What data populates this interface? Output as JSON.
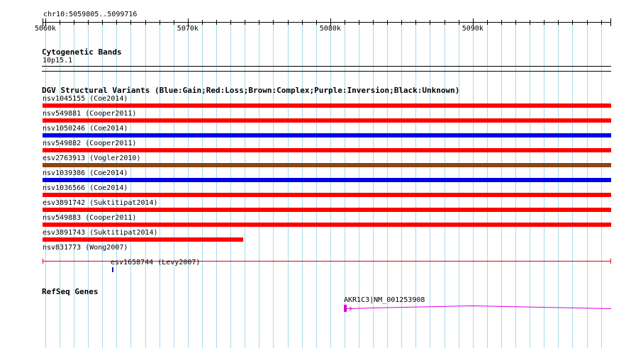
{
  "ruler": {
    "position_label": "chr10:5059805..5099716",
    "region_start": 5059805,
    "region_end": 5099716,
    "ticks": [
      {
        "pos": 5060000,
        "label": "5060k"
      },
      {
        "pos": 5070000,
        "label": "5070k"
      },
      {
        "pos": 5080000,
        "label": "5080k"
      },
      {
        "pos": 5090000,
        "label": "5090k"
      }
    ]
  },
  "cytobands": {
    "title": "Cytogenetic Bands",
    "band_label": "10p15.1"
  },
  "dgv": {
    "title": "DGV Structural Variants (Blue:Gain;Red:Loss;Brown:Complex;Purple:Inversion;Black:Unknown)",
    "colors": {
      "gain": "#0000e6",
      "loss": "#ff0000",
      "complex": "#8b4513",
      "line": "#ee0000",
      "tick": "#1515aa"
    },
    "variants": [
      {
        "label": "nsv1045155 (Coe2014)",
        "type": "loss",
        "start": 5059805,
        "end": 5099716
      },
      {
        "label": "nsv549881 (Cooper2011)",
        "type": "loss",
        "start": 5059805,
        "end": 5099716
      },
      {
        "label": "nsv1050246 (Coe2014)",
        "type": "gain",
        "start": 5059805,
        "end": 5099716
      },
      {
        "label": "nsv549882 (Cooper2011)",
        "type": "loss",
        "start": 5059805,
        "end": 5099716
      },
      {
        "label": "esv2763913 (Vogler2010)",
        "type": "complex",
        "start": 5059805,
        "end": 5099716
      },
      {
        "label": "nsv1039386 (Coe2014)",
        "type": "gain",
        "start": 5059805,
        "end": 5099716
      },
      {
        "label": "nsv1036566 (Coe2014)",
        "type": "loss",
        "start": 5059805,
        "end": 5099716
      },
      {
        "label": "esv3891742 (Suktitipat2014)",
        "type": "loss",
        "start": 5059805,
        "end": 5099716
      },
      {
        "label": "nsv549883 (Cooper2011)",
        "type": "loss",
        "start": 5059805,
        "end": 5099716
      },
      {
        "label": "esv3891743 (Suktitipat2014)",
        "type": "loss",
        "start": 5059805,
        "end": 5073900
      },
      {
        "label": "nsv831773 (Wong2007)",
        "type": "loss-line",
        "start": 5059805,
        "end": 5099716
      }
    ],
    "small_variant": {
      "label": "esv1658744 (Levy2007)",
      "pos": 5064700
    }
  },
  "refseq": {
    "title": "RefSeq Genes",
    "gene": {
      "label": "AKR1C3|NM_001253908",
      "start": 5080950,
      "end": 5099716
    },
    "colors": {
      "gene": "#dd00dd"
    }
  }
}
